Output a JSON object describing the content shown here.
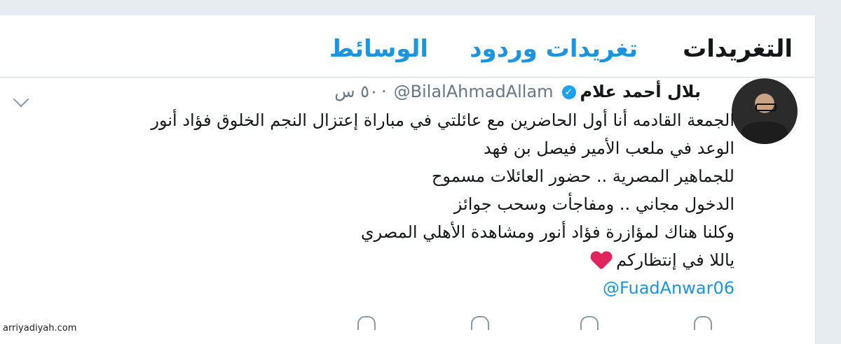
{
  "tabs": [
    "التغريدات",
    "تغريدات وردود",
    "الوسائط"
  ],
  "tweet": {
    "author_name": "بلال أحمد علام",
    "handle": "@BilalAhmadAllam",
    "separator": "·",
    "time": "٥٠ س",
    "lines": [
      "الجمعة القادمه أنا أول الحاضرين مع عائلتي في مباراة إعتزال النجم الخلوق فؤاد أنور",
      "الوعد في ملعب الأمير فيصل بن فهد",
      "للجماهير المصرية .. حضور العائلات مسموح",
      "الدخول مجاني .. ومفاجأت وسحب جوائز",
      "وكلنا هناك لمؤازرة فؤاد أنور ومشاهدة الأهلي المصري",
      "ياللا في إنتظاركم"
    ],
    "mention": "@FuadAnwar06"
  },
  "colors": {
    "accent": "#1b95e0",
    "heart": "#e0245e"
  },
  "icons": [
    "verified-badge-icon",
    "chevron-down-icon",
    "heart-icon",
    "reply-icon",
    "retweet-icon",
    "like-icon",
    "share-icon"
  ],
  "watermark": "arriyadiyah.com"
}
